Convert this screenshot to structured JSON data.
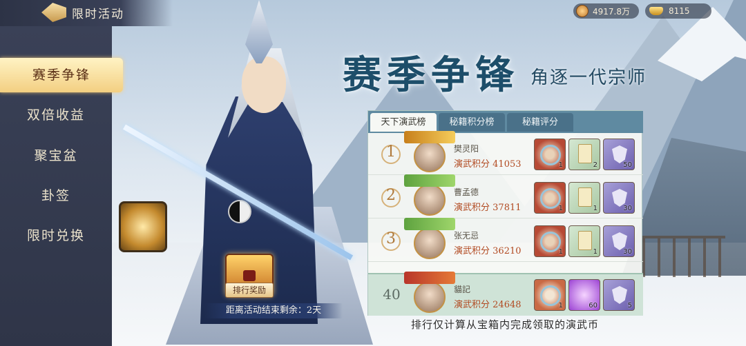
{
  "topbar": {
    "title": "限时活动"
  },
  "currency": {
    "coins": "4917.8万",
    "ingots": "8115"
  },
  "sidebar": {
    "items": [
      {
        "label": "赛季争锋",
        "active": true
      },
      {
        "label": "双倍收益",
        "active": false
      },
      {
        "label": "聚宝盆",
        "active": false
      },
      {
        "label": "卦签",
        "active": false
      },
      {
        "label": "限时兑换",
        "active": false
      }
    ]
  },
  "banner": {
    "title": "赛季争锋",
    "subtitle": "角逐一代宗师"
  },
  "panel": {
    "tabs": [
      {
        "label": "天下演武榜",
        "active": true
      },
      {
        "label": "秘籍积分榜",
        "active": false
      },
      {
        "label": "秘籍评分",
        "active": false
      }
    ],
    "score_label": "演武积分",
    "rows": [
      {
        "rank": "1",
        "name": "樊灵阳",
        "score": "41053",
        "rewards": [
          "1",
          "2",
          "50"
        ]
      },
      {
        "rank": "2",
        "name": "曹孟德",
        "score": "37811",
        "rewards": [
          "1",
          "1",
          "30"
        ]
      },
      {
        "rank": "3",
        "name": "张无忌",
        "score": "36210",
        "rewards": [
          "1",
          "1",
          "30"
        ]
      }
    ],
    "my_row": {
      "rank": "40",
      "name": "貓記",
      "score": "24648",
      "rewards": [
        "1",
        "60",
        "5"
      ]
    }
  },
  "chest": {
    "label": "排行奖励"
  },
  "countdown": "距离活动结束剩余：2天",
  "footer_note": "排行仅计算从宝箱内完成领取的演武币"
}
